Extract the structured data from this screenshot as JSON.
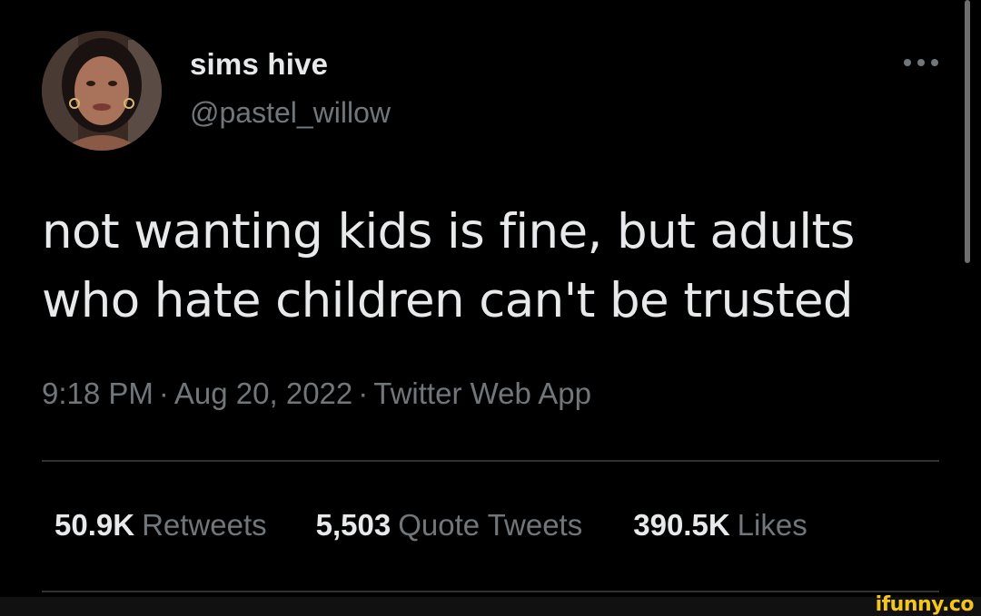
{
  "user": {
    "display_name": "sims hive",
    "handle": "@pastel_willow",
    "avatar_icon": "profile-photo"
  },
  "tweet": {
    "text_line1": "not wanting kids is fine, but adults",
    "text_line2": "who hate children can't be trusted",
    "time": "9:18 PM",
    "date": "Aug 20, 2022",
    "source": "Twitter Web App",
    "separator": "·"
  },
  "stats": {
    "retweets_count": "50.9K",
    "retweets_label": "Retweets",
    "quotes_count": "5,503",
    "quotes_label": "Quote Tweets",
    "likes_count": "390.5K",
    "likes_label": "Likes"
  },
  "more_icon": "more-horizontal",
  "watermark": "ifunny.co",
  "colors": {
    "background": "#000000",
    "primary_text": "#e7e9ea",
    "secondary_text": "#71767b",
    "divider": "#2f3336",
    "watermark": "#f5c518"
  }
}
